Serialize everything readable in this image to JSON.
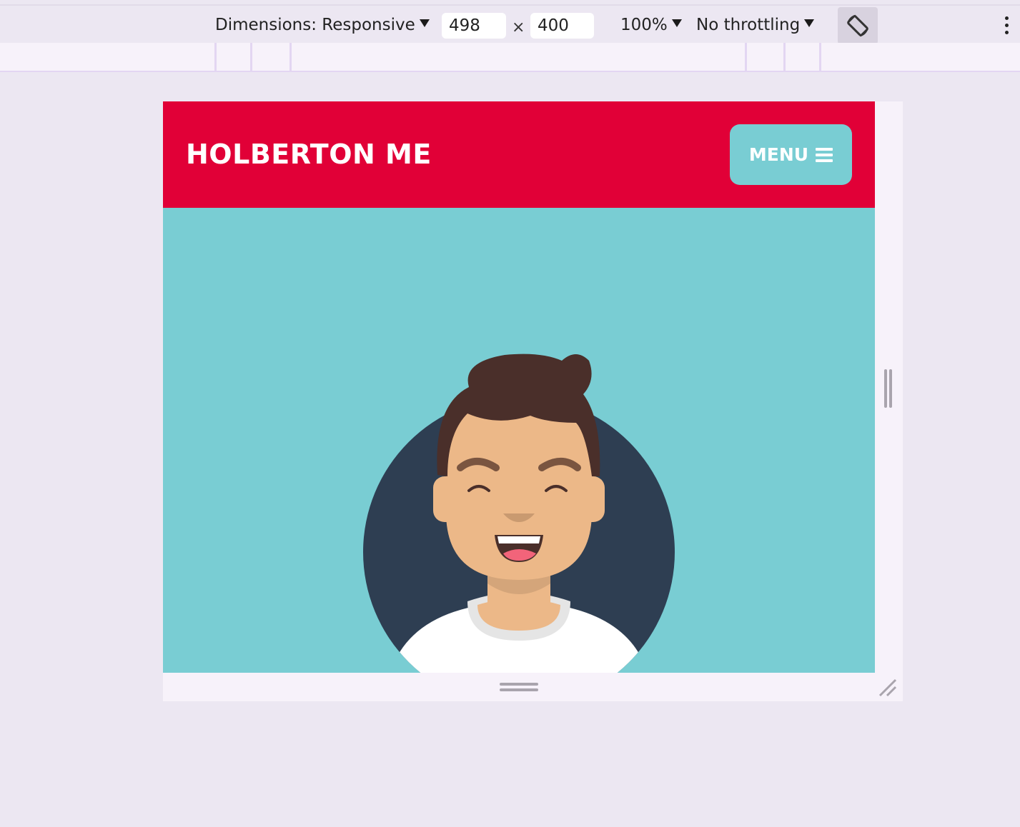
{
  "devtools": {
    "dimensions_label": "Dimensions: Responsive",
    "width_value": "498",
    "times_symbol": "×",
    "height_value": "400",
    "zoom": "100%",
    "throttling": "No throttling"
  },
  "site": {
    "title": "HOLBERTON ME",
    "menu_label": "MENU",
    "colors": {
      "header": "#e10037",
      "accent": "#79cdd3",
      "avatar_circle": "#2e3e52",
      "hair": "#4a2f2a",
      "skin": "#ecb888"
    }
  }
}
